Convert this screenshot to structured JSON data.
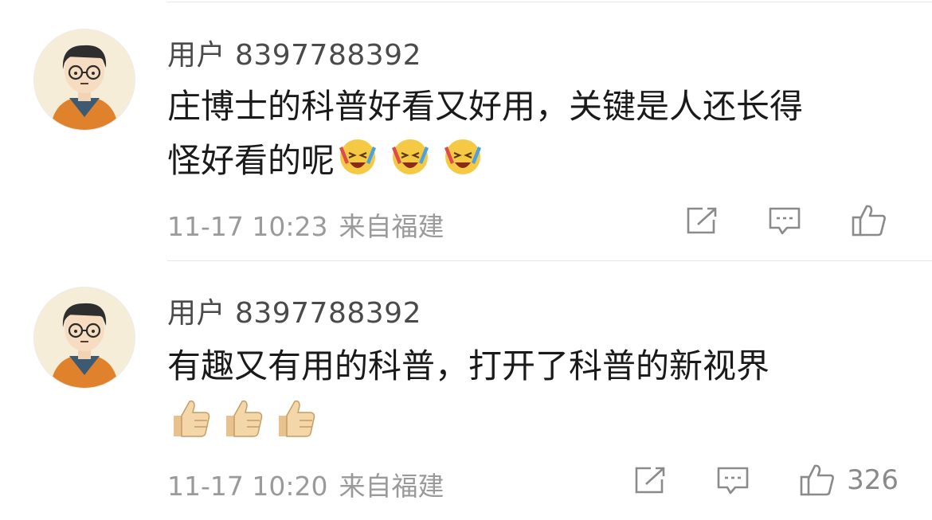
{
  "comments": [
    {
      "username": "用户 8397788392",
      "content_lines": [
        "庄博士的科普好看又好用，关键是人还长得",
        "怪好看的呢"
      ],
      "emoji_name": "laugh-cry-emoji",
      "emoji_count": 3,
      "time": "11-17 10:23",
      "location": "来自福建",
      "like_count": ""
    },
    {
      "username": "用户 8397788392",
      "content_lines": [
        "有趣又有用的科普，打开了科普的新视界",
        ""
      ],
      "emoji_name": "thumbs-up-emoji",
      "emoji_count": 3,
      "time": "11-17 10:20",
      "location": "来自福建",
      "like_count": "326"
    }
  ],
  "icons": {
    "share": "share-icon",
    "comment": "comment-icon",
    "like": "like-icon"
  },
  "colors": {
    "text": "#1a1a1a",
    "username": "#4a4a4a",
    "meta": "#9a9a9a",
    "icon": "#8a8a8a"
  }
}
